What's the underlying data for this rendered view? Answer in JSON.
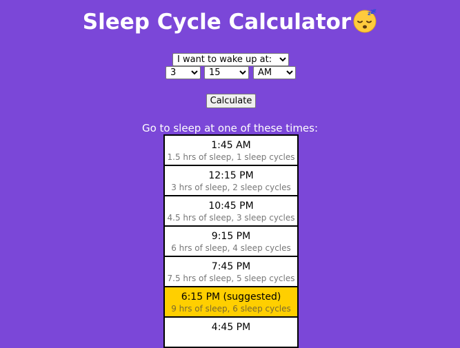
{
  "header": {
    "title": "Sleep Cycle Calculator",
    "emoji": "sleeping-face-emoji"
  },
  "form": {
    "mode": "I want to wake up at:",
    "hour": "3",
    "minute": "15",
    "ampm": "AM",
    "calculate_label": "Calculate"
  },
  "results": {
    "heading": "Go to sleep at one of these times:",
    "items": [
      {
        "time": "1:45 AM",
        "detail": "1.5 hrs of sleep, 1 sleep cycles",
        "suggested": false
      },
      {
        "time": "12:15 PM",
        "detail": "3 hrs of sleep, 2 sleep cycles",
        "suggested": false
      },
      {
        "time": "10:45 PM",
        "detail": "4.5 hrs of sleep, 3 sleep cycles",
        "suggested": false
      },
      {
        "time": "9:15 PM",
        "detail": "6 hrs of sleep, 4 sleep cycles",
        "suggested": false
      },
      {
        "time": "7:45 PM",
        "detail": "7.5 hrs of sleep, 5 sleep cycles",
        "suggested": false
      },
      {
        "time": "6:15 PM (suggested)",
        "detail": "9 hrs of sleep, 6 sleep cycles",
        "suggested": true
      },
      {
        "time": "4:45 PM",
        "detail": "",
        "suggested": false
      }
    ]
  },
  "colors": {
    "background": "#7b47d8",
    "suggested": "#ffcf00",
    "text": "#ffffff"
  }
}
